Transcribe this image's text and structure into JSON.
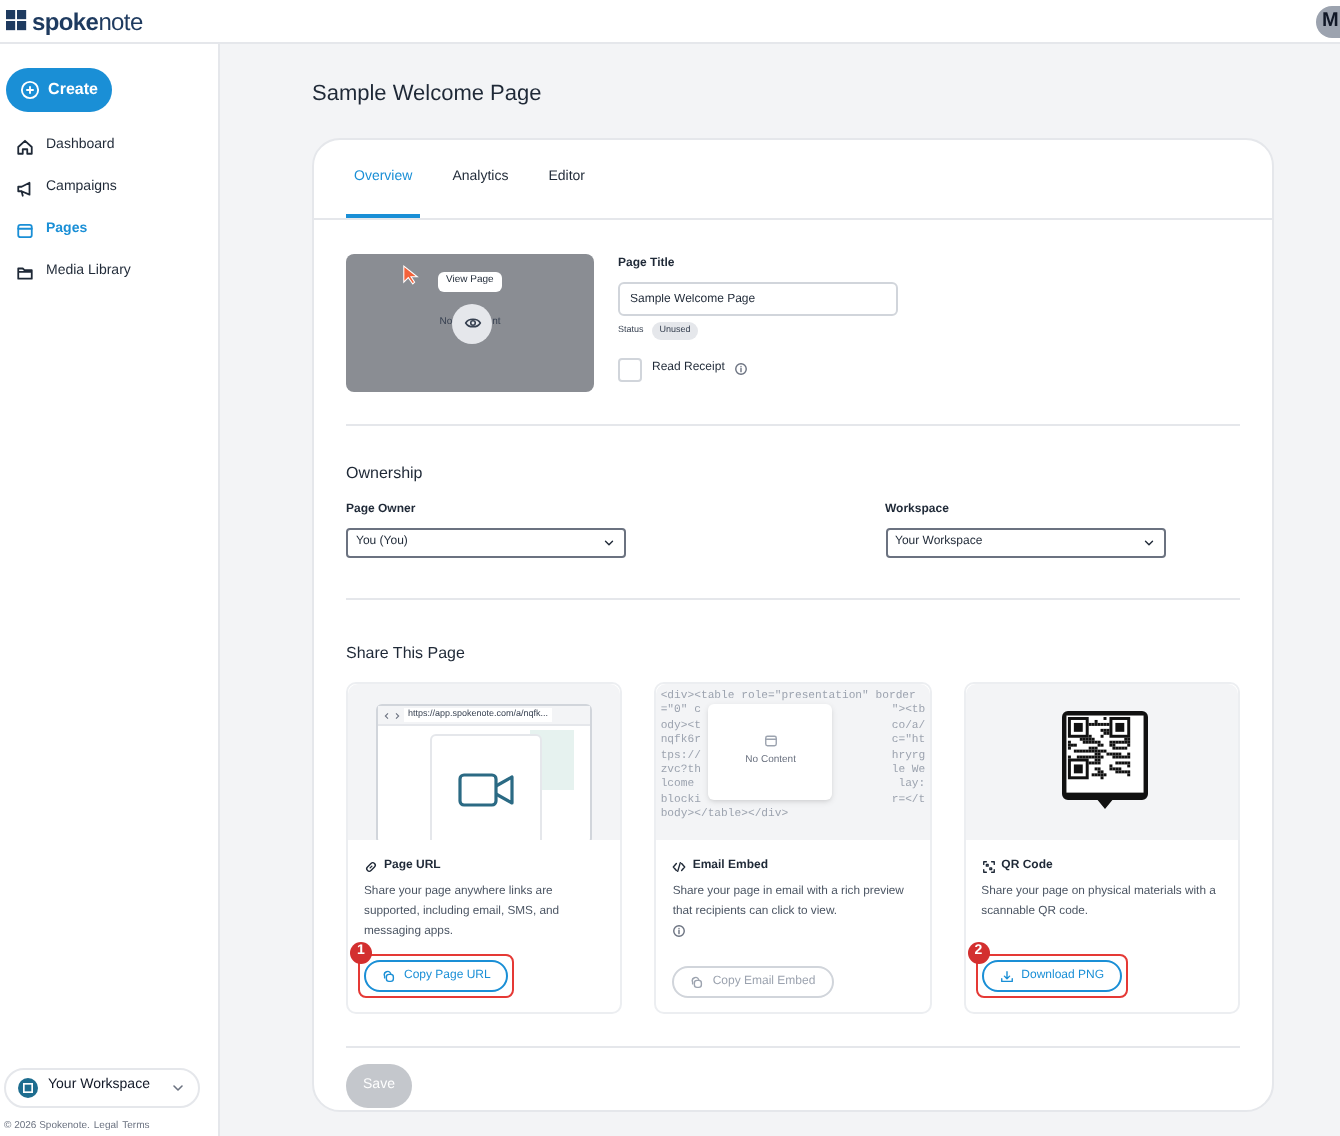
{
  "brand": {
    "name_bold": "spoke",
    "name_light": "note"
  },
  "avatar": {
    "initial": "M"
  },
  "sidebar": {
    "create_label": "Create",
    "items": [
      {
        "label": "Dashboard",
        "selected": false
      },
      {
        "label": "Campaigns",
        "selected": false
      },
      {
        "label": "Pages",
        "selected": true
      },
      {
        "label": "Media Library",
        "selected": false
      }
    ],
    "workspace": "Your Workspace",
    "footer": {
      "copyright": "© 2026 Spokenote.",
      "links": [
        "Legal",
        "Terms"
      ]
    }
  },
  "page_title": "Sample Welcome Page",
  "tabs": [
    {
      "label": "Overview",
      "selected": true
    },
    {
      "label": "Analytics",
      "selected": false
    },
    {
      "label": "Editor",
      "selected": false
    }
  ],
  "thumbnail": {
    "tooltip": "View Page",
    "text_left": "No",
    "text_right": "nt"
  },
  "details": {
    "title_label": "Page Title",
    "title_value": "Sample Welcome Page",
    "status_label": "Status",
    "status_value": "Unused",
    "read_receipt_label": "Read Receipt",
    "read_receipt_checked": false
  },
  "ownership": {
    "heading": "Ownership",
    "owner_label": "Page Owner",
    "owner_value": "You (You)",
    "workspace_label": "Workspace",
    "workspace_value": "Your Workspace"
  },
  "share": {
    "heading": "Share This Page",
    "cards": [
      {
        "kind": "url",
        "title": "Page URL",
        "description": "Share your page anywhere links are supported, including email, SMS, and messaging apps.",
        "info": false,
        "button": "Copy Page URL",
        "disabled": false,
        "marker": "1",
        "url": "https://app.spokenote.com/a/nqfk..."
      },
      {
        "kind": "embed",
        "title": "Email Embed",
        "description": "Share your page in email with a rich preview that recipients can click to view.",
        "info": true,
        "button": "Copy Email Embed",
        "disabled": true,
        "popup": "No Content",
        "code_lines": [
          {
            "left": "<div><table role=\"presentation\" border"
          },
          {
            "left": "=\"0\" c",
            "right": "\"><tb"
          },
          {
            "left": "ody><t",
            "right": "co/a/"
          },
          {
            "left": "nqfk6r",
            "right": "c=\"ht"
          },
          {
            "left": "tps://",
            "right": "hryrg"
          },
          {
            "left": "zvc?th",
            "right": "le We"
          },
          {
            "left": "lcome",
            "right": "lay:"
          },
          {
            "left": "blocki",
            "right": "r=</t"
          },
          {
            "left": "body></table></div>"
          }
        ]
      },
      {
        "kind": "qr",
        "title": "QR Code",
        "description": "Share your page on physical materials with a scannable QR code.",
        "info": false,
        "button": "Download PNG",
        "disabled": false,
        "marker": "2"
      }
    ]
  },
  "save_button": {
    "label": "Save",
    "disabled": true
  }
}
